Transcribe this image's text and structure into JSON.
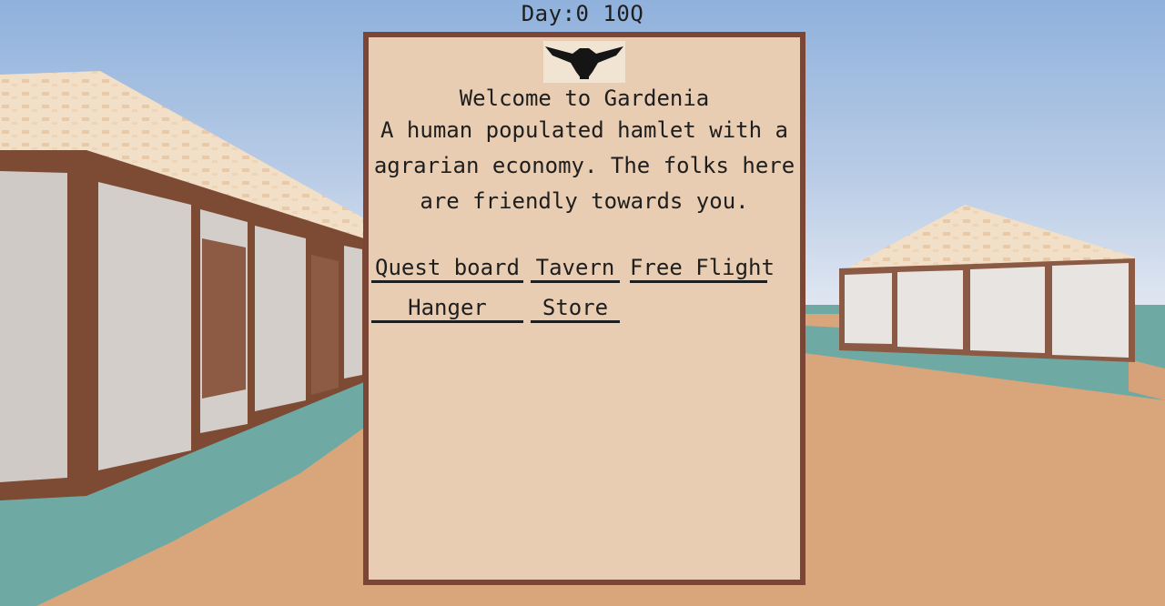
{
  "hud": {
    "status_text": "Day:0 10Q"
  },
  "panel": {
    "emblem_icon": "eagle-emblem-icon",
    "welcome_text": "Welcome to Gardenia",
    "description_lines": [
      "A human populated hamlet with a",
      "agrarian economy. The folks here",
      "are friendly towards you."
    ],
    "buttons": {
      "quest_board": "Quest board",
      "tavern": "Tavern",
      "free_flight": "Free Flight",
      "hanger": "Hanger",
      "store": "Store"
    }
  },
  "colors": {
    "sky_top": "#8fb1dc",
    "sky_bottom": "#dfe6f1",
    "sea": "#6ea9a4",
    "sand": "#d9a67c",
    "panel_bg": "#e8cdb2",
    "panel_border": "#7b4636",
    "wall": "#cfcac5",
    "timber": "#7d4a34",
    "roof": "#f1dec6"
  }
}
